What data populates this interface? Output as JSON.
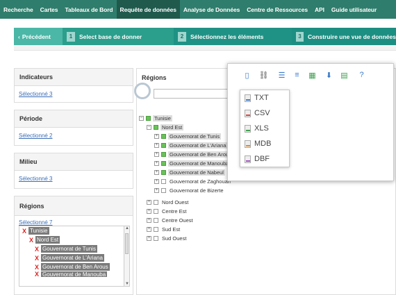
{
  "nav": {
    "items": [
      "Recherche",
      "Cartes",
      "Tableaux de Bord",
      "Requête de données",
      "Analyse de Données",
      "Centre de Ressources",
      "API",
      "Guide utilisateur"
    ],
    "active_index": 3
  },
  "steps": {
    "prev_label": "Précédent",
    "step1": {
      "num": "1",
      "label": "Select base de donner"
    },
    "step2": {
      "num": "2",
      "label": "Sélectionnez les éléments"
    },
    "step3": {
      "num": "3",
      "label": "Construire une vue de données"
    }
  },
  "left": {
    "indicateurs": {
      "title": "Indicateurs",
      "link": "Sélectionné 3"
    },
    "periode": {
      "title": "Période",
      "link": "Sélectionné 2"
    },
    "milieu": {
      "title": "Milieu",
      "link": "Sélectionné 3"
    },
    "regions": {
      "title": "Régions",
      "link": "Sélectionné 7",
      "items": [
        "Tunisie",
        "Nord Est",
        "Gouvernorat de Tunis",
        "Gouvernorat de L'Ariana",
        "Gouvernorat de Ben Arous",
        "Gouvernorat de Manouba"
      ]
    }
  },
  "regions_panel": {
    "title": "Régions",
    "tree": [
      {
        "label": "Tunisie",
        "level": 0,
        "exp": "⊟",
        "checked": true
      },
      {
        "label": "Nord Est",
        "level": 1,
        "exp": "⊟",
        "checked": true
      },
      {
        "label": "Gouvernorat de Tunis",
        "level": 2,
        "exp": "⊞",
        "checked": true
      },
      {
        "label": "Gouvernorat de L'Ariana",
        "level": 2,
        "exp": "⊞",
        "checked": true
      },
      {
        "label": "Gouvernorat de Ben Arous",
        "level": 2,
        "exp": "⊞",
        "checked": true
      },
      {
        "label": "Gouvernorat de Manouba",
        "level": 2,
        "exp": "⊞",
        "checked": true
      },
      {
        "label": "Gouvernorat de Nabeul",
        "level": 2,
        "exp": "⊞",
        "checked": true
      },
      {
        "label": "Gouvernorat de Zaghouan",
        "level": 2,
        "exp": "⊞",
        "checked": false
      },
      {
        "label": "Gouvernorat de Bizerte",
        "level": 2,
        "exp": "⊞",
        "checked": false
      },
      {
        "label": "Nord Ouest",
        "level": 1,
        "exp": "⊞",
        "checked": false
      },
      {
        "label": "Centre Est",
        "level": 1,
        "exp": "⊞",
        "checked": false
      },
      {
        "label": "Centre Ouest",
        "level": 1,
        "exp": "⊞",
        "checked": false
      },
      {
        "label": "Sud Est",
        "level": 1,
        "exp": "⊞",
        "checked": false
      },
      {
        "label": "Sud Ouest",
        "level": 1,
        "exp": "⊞",
        "checked": false
      }
    ]
  },
  "export_menu": {
    "toolbar_icons": [
      "document-icon",
      "link-icon",
      "list-icon",
      "rows-icon",
      "excel-icon",
      "download-icon",
      "chart-icon",
      "help-icon"
    ],
    "formats": [
      "TXT",
      "CSV",
      "XLS",
      "MDB",
      "DBF"
    ]
  },
  "colors": {
    "nav_bg": "#2f7d6c",
    "step_bg": "#2b9e8c",
    "checkbox_on": "#6ac25a",
    "remove_x": "#dd2222"
  }
}
